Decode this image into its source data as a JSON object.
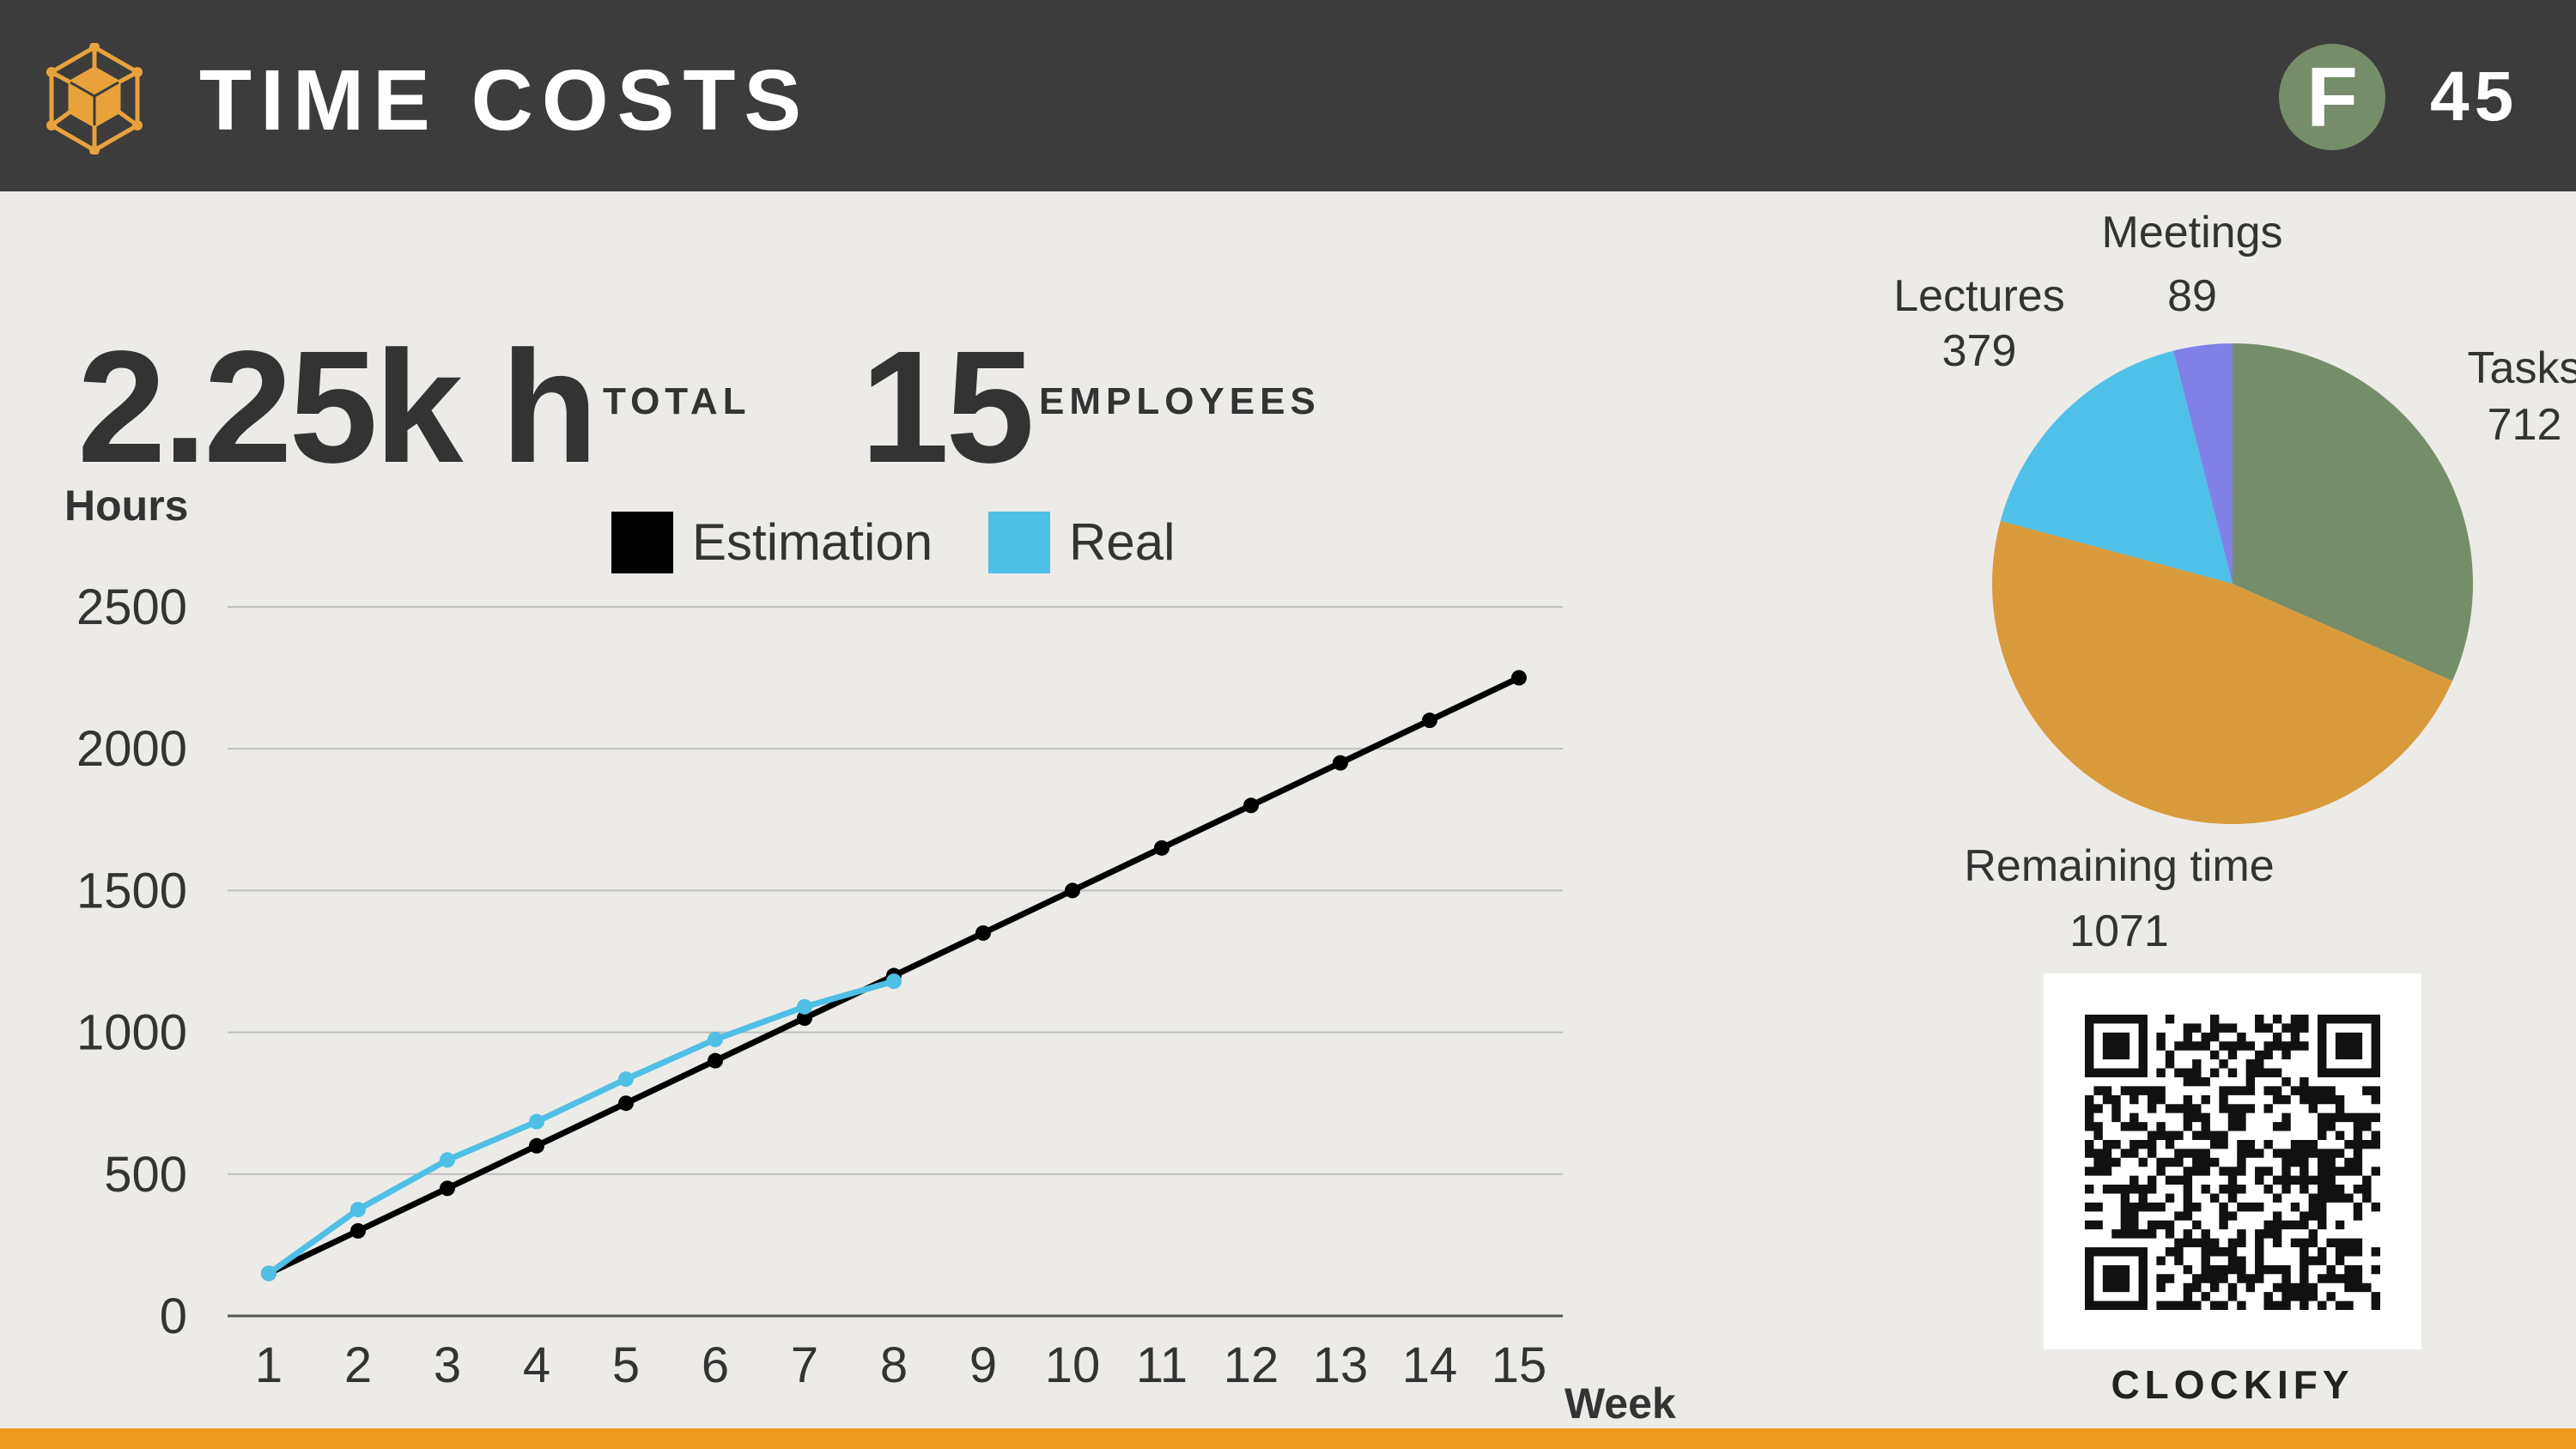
{
  "header": {
    "title": "TIME COSTS",
    "badge": "F",
    "score": "45"
  },
  "kpis": {
    "total_value": "2.25k h",
    "total_label": "TOTAL",
    "employees_value": "15",
    "employees_label": "EMPLOYEES"
  },
  "colors": {
    "header_bg": "#3c3c3c",
    "accent_orange": "#ee9a1f",
    "estimation": "#000000",
    "real": "#4fbfe6",
    "tasks": "#768d6a",
    "remaining": "#d99a3b",
    "lectures": "#4fc0e8",
    "meetings": "#8080e6"
  },
  "icons": {
    "logo": "hexagon-cube-icon"
  },
  "chart_data": [
    {
      "type": "line",
      "ylabel": "Hours",
      "xlabel": "Week",
      "ylim": [
        0,
        2500
      ],
      "yticks": [
        0,
        500,
        1000,
        1500,
        2000,
        2500
      ],
      "x": [
        1,
        2,
        3,
        4,
        5,
        6,
        7,
        8,
        9,
        10,
        11,
        12,
        13,
        14,
        15
      ],
      "grid": true,
      "legend": "top",
      "series": [
        {
          "name": "Estimation",
          "color": "#000000",
          "values": [
            150,
            300,
            450,
            600,
            750,
            900,
            1050,
            1200,
            1350,
            1500,
            1650,
            1800,
            1950,
            2100,
            2250
          ]
        },
        {
          "name": "Real",
          "color": "#4fbfe6",
          "values": [
            150,
            375,
            550,
            685,
            835,
            975,
            1090,
            1180
          ]
        }
      ]
    },
    {
      "type": "pie",
      "slices": [
        {
          "label": "Tasks",
          "value": 712,
          "color": "#768d6a"
        },
        {
          "label": "Remaining time",
          "value": 1071,
          "color": "#d99a3b"
        },
        {
          "label": "Lectures",
          "value": 379,
          "color": "#4fc0e8"
        },
        {
          "label": "Meetings",
          "value": 89,
          "color": "#8080e6"
        }
      ]
    }
  ],
  "qr": {
    "label": "CLOCKIFY LINK"
  }
}
